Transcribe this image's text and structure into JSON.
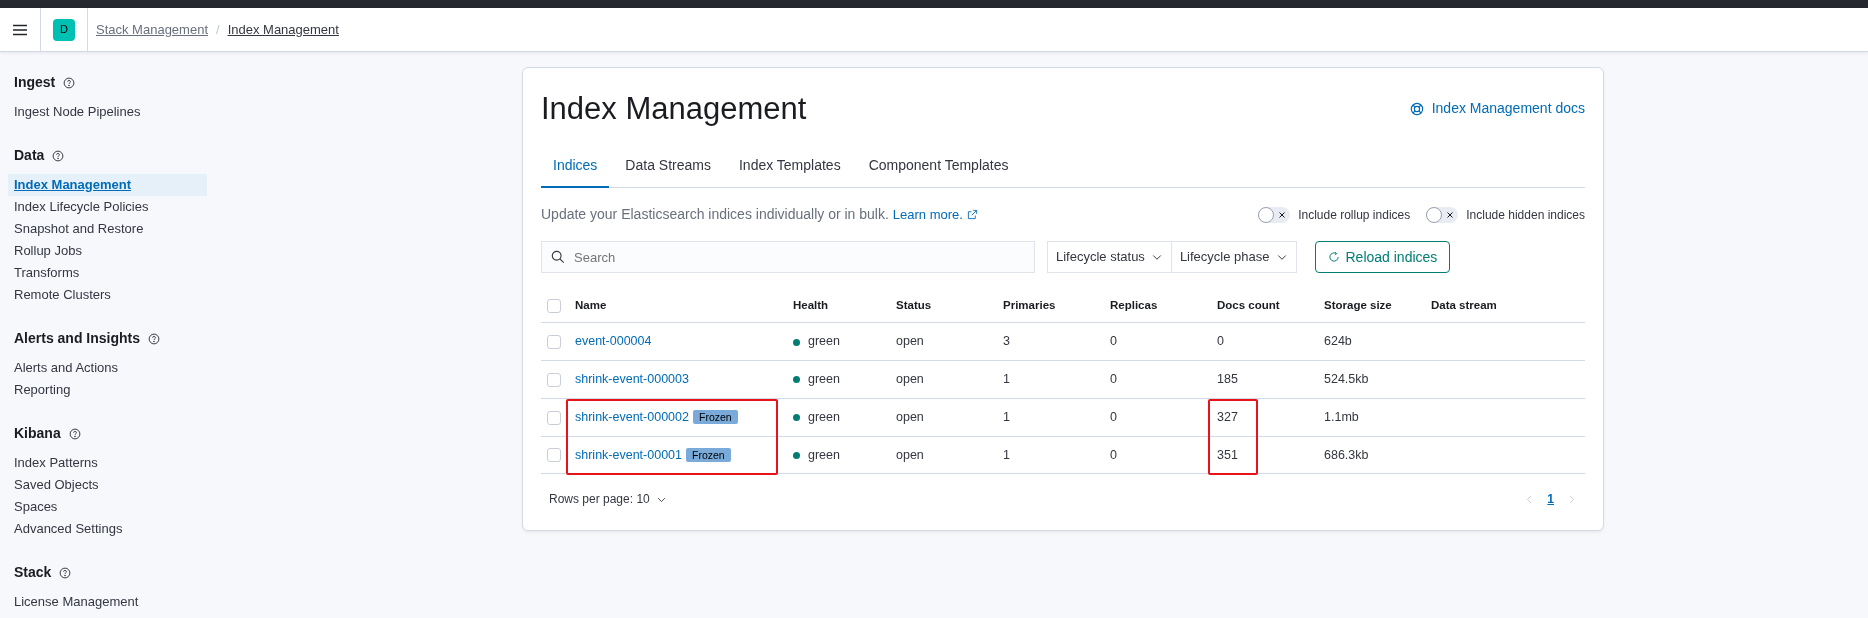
{
  "header": {
    "avatar": "D",
    "separator": "/",
    "breadcrumbs": [
      {
        "label": "Stack Management",
        "current": false
      },
      {
        "label": "Index Management",
        "current": true
      }
    ]
  },
  "sidebar": {
    "sections": [
      {
        "title": "Ingest",
        "items": [
          {
            "label": "Ingest Node Pipelines",
            "selected": false
          }
        ]
      },
      {
        "title": "Data",
        "items": [
          {
            "label": "Index Management",
            "selected": true
          },
          {
            "label": "Index Lifecycle Policies",
            "selected": false
          },
          {
            "label": "Snapshot and Restore",
            "selected": false
          },
          {
            "label": "Rollup Jobs",
            "selected": false
          },
          {
            "label": "Transforms",
            "selected": false
          },
          {
            "label": "Remote Clusters",
            "selected": false
          }
        ]
      },
      {
        "title": "Alerts and Insights",
        "items": [
          {
            "label": "Alerts and Actions",
            "selected": false
          },
          {
            "label": "Reporting",
            "selected": false
          }
        ]
      },
      {
        "title": "Kibana",
        "items": [
          {
            "label": "Index Patterns",
            "selected": false
          },
          {
            "label": "Saved Objects",
            "selected": false
          },
          {
            "label": "Spaces",
            "selected": false
          },
          {
            "label": "Advanced Settings",
            "selected": false
          }
        ]
      },
      {
        "title": "Stack",
        "items": [
          {
            "label": "License Management",
            "selected": false
          }
        ]
      }
    ]
  },
  "page": {
    "title": "Index Management",
    "docs_link": "Index Management docs",
    "tabs": [
      {
        "label": "Indices",
        "selected": true
      },
      {
        "label": "Data Streams",
        "selected": false
      },
      {
        "label": "Index Templates",
        "selected": false
      },
      {
        "label": "Component Templates",
        "selected": false
      }
    ],
    "description": "Update your Elasticsearch indices individually or in bulk.",
    "learn_more": "Learn more.",
    "toggles": [
      {
        "label": "Include rollup indices",
        "on": false
      },
      {
        "label": "Include hidden indices",
        "on": false
      }
    ],
    "search": {
      "placeholder": "Search"
    },
    "filters": [
      "Lifecycle status",
      "Lifecycle phase"
    ],
    "reload_button": "Reload indices"
  },
  "table": {
    "select_all_checked": false,
    "columns": [
      "Name",
      "Health",
      "Status",
      "Primaries",
      "Replicas",
      "Docs count",
      "Storage size",
      "Data stream"
    ],
    "rows": [
      {
        "checked": false,
        "name": "event-000004",
        "health": "green",
        "status": "open",
        "primaries": "3",
        "replicas": "0",
        "docs_count": "0",
        "storage_size": "624b"
      },
      {
        "checked": false,
        "name": "shrink-event-000003",
        "health": "green",
        "status": "open",
        "primaries": "1",
        "replicas": "0",
        "docs_count": "185",
        "storage_size": "524.5kb"
      },
      {
        "checked": false,
        "name": "shrink-event-000002",
        "badge": "Frozen",
        "name_highlighted": true,
        "docs_highlighted": true,
        "health": "green",
        "status": "open",
        "primaries": "1",
        "replicas": "0",
        "docs_count": "327",
        "storage_size": "1.1mb"
      },
      {
        "checked": false,
        "name": "shrink-event-00001",
        "badge": "Frozen",
        "name_highlighted": true,
        "docs_highlighted": true,
        "health": "green",
        "status": "open",
        "primaries": "1",
        "replicas": "0",
        "docs_count": "351",
        "storage_size": "686.3kb"
      }
    ],
    "rows_per_page": "Rows per page: 10",
    "pages": [
      {
        "label": "1",
        "selected": true
      }
    ]
  }
}
